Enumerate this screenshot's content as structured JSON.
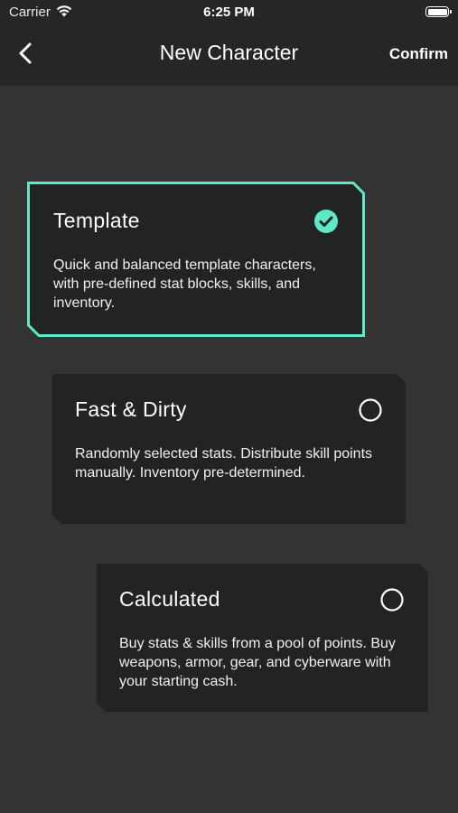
{
  "status_bar": {
    "carrier": "Carrier",
    "time": "6:25 PM"
  },
  "nav": {
    "title": "New Character",
    "confirm_label": "Confirm",
    "back_icon": "chevron-left-icon"
  },
  "options": [
    {
      "title": "Template",
      "description": "Quick and balanced template characters, with pre-defined stat blocks, skills, and inventory.",
      "selected": true
    },
    {
      "title": "Fast & Dirty",
      "description": "Randomly selected stats. Distribute skill points manually. Inventory pre-determined.",
      "selected": false
    },
    {
      "title": "Calculated",
      "description": "Buy stats & skills from a pool of points. Buy weapons, armor, gear, and cyberware with your starting cash.",
      "selected": false
    }
  ],
  "colors": {
    "accent": "#5ee8c8",
    "background": "#333333",
    "topbar": "#262626",
    "card": "#232323"
  }
}
